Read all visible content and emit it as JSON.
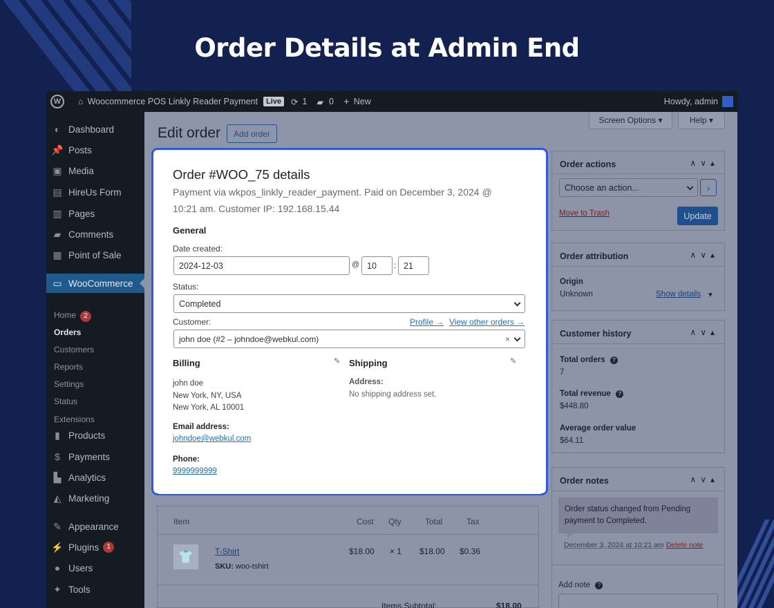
{
  "headline": "Order Details at Admin End",
  "adminbar": {
    "site": "Woocommerce POS Linkly Reader Payment",
    "live": "Live",
    "updates": "1",
    "comments": "0",
    "new": "New",
    "howdy": "Howdy, admin"
  },
  "sidebar": {
    "items": [
      {
        "label": "Dashboard",
        "icon": "dashboard-icon"
      },
      {
        "label": "Posts",
        "icon": "pin-icon"
      },
      {
        "label": "Media",
        "icon": "media-icon"
      },
      {
        "label": "HireUs Form",
        "icon": "form-icon"
      },
      {
        "label": "Pages",
        "icon": "pages-icon"
      },
      {
        "label": "Comments",
        "icon": "comment-icon"
      },
      {
        "label": "Point of Sale",
        "icon": "pos-icon"
      },
      {
        "label": "WooCommerce",
        "icon": "woo-icon"
      },
      {
        "label": "Products",
        "icon": "products-icon"
      },
      {
        "label": "Payments",
        "icon": "payments-icon"
      },
      {
        "label": "Analytics",
        "icon": "analytics-icon"
      },
      {
        "label": "Marketing",
        "icon": "marketing-icon"
      },
      {
        "label": "Appearance",
        "icon": "appearance-icon"
      },
      {
        "label": "Plugins",
        "icon": "plugins-icon"
      },
      {
        "label": "Users",
        "icon": "users-icon"
      },
      {
        "label": "Tools",
        "icon": "tools-icon"
      }
    ],
    "submenu": [
      "Home",
      "Orders",
      "Customers",
      "Reports",
      "Settings",
      "Status",
      "Extensions"
    ],
    "home_badge": "2",
    "plugins_badge": "1"
  },
  "header": {
    "title": "Edit order",
    "add_order": "Add order",
    "screen_options": "Screen Options",
    "help": "Help"
  },
  "order": {
    "title": "Order #WOO_75 details",
    "subtitle_line1": "Payment via wkpos_linkly_reader_payment. Paid on December 3, 2024 @",
    "subtitle_line2": "10:21 am. Customer IP: 192.168.15.44",
    "general": "General",
    "date_label": "Date created:",
    "date": "2024-12-03",
    "at": "@",
    "hour": "10",
    "colon": ":",
    "minute": "21",
    "status_label": "Status:",
    "status": "Completed",
    "customer_label": "Customer:",
    "profile_link": "Profile →",
    "other_orders_link": "View other orders →",
    "customer": "john doe (#2 – johndoe@webkul.com)",
    "clear": "×",
    "billing": "Billing",
    "billing_lines": [
      "john doe",
      "New York, NY, USA",
      "New York, AL 10001"
    ],
    "email_label": "Email address:",
    "email": "johndoe@webkul.com",
    "phone_label": "Phone:",
    "phone": "9999999999",
    "shipping": "Shipping",
    "address_label": "Address:",
    "no_shipping": "No shipping address set."
  },
  "items": {
    "headers": [
      "Item",
      "Cost",
      "Qty",
      "Total",
      "Tax"
    ],
    "row": {
      "name": "T-Shirt",
      "sku_label": "SKU:",
      "sku": "woo-tshirt",
      "cost": "$18.00",
      "qty": "× 1",
      "total": "$18.00",
      "tax": "$0.36"
    },
    "subtotal_label": "Items Subtotal:",
    "subtotal": "$18.00"
  },
  "actions": {
    "title": "Order actions",
    "choose": "Choose an action...",
    "trash": "Move to Trash",
    "update": "Update"
  },
  "attribution": {
    "title": "Order attribution",
    "origin_label": "Origin",
    "origin": "Unknown",
    "show_details": "Show details"
  },
  "history": {
    "title": "Customer history",
    "total_orders_label": "Total orders",
    "total_orders": "7",
    "total_revenue_label": "Total revenue",
    "total_revenue": "$448.80",
    "aov_label": "Average order value",
    "aov": "$64.11"
  },
  "notes": {
    "title": "Order notes",
    "note": "Order status changed from Pending payment to Completed.",
    "note_meta": "December 3, 2024 at 10:21 am",
    "delete": "Delete note",
    "add_note": "Add note"
  }
}
